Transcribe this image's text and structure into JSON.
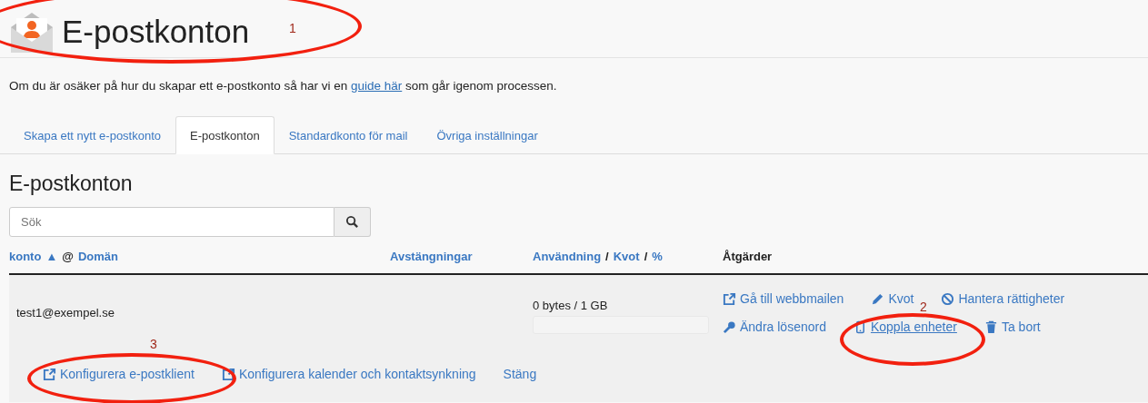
{
  "page_title": "E-postkonton",
  "intro": {
    "before": "Om du är osäker på hur du skapar ett e-postkonto så har vi en",
    "link": "guide här",
    "after": "som går igenom processen."
  },
  "tabs": [
    {
      "label": "Skapa ett nytt e-postkonto",
      "selected": false
    },
    {
      "label": "E-postkonton",
      "selected": true
    },
    {
      "label": "Standardkonto för mail",
      "selected": false
    },
    {
      "label": "Övriga inställningar",
      "selected": false
    }
  ],
  "section_title": "E-postkonton",
  "search": {
    "placeholder": "Sök"
  },
  "table": {
    "columns": [
      {
        "parts": [
          {
            "text": "konto",
            "link": true
          },
          {
            "text": "▲",
            "link": true
          },
          {
            "text": "@",
            "link": false
          },
          {
            "text": "Domän",
            "link": true
          }
        ]
      },
      {
        "parts": [
          {
            "text": "Avstängningar",
            "link": true
          }
        ]
      },
      {
        "parts": [
          {
            "text": "Användning",
            "link": true
          },
          {
            "text": "/",
            "link": false
          },
          {
            "text": "Kvot",
            "link": true
          },
          {
            "text": "/",
            "link": false
          },
          {
            "text": "%",
            "link": true
          }
        ]
      },
      {
        "parts": [
          {
            "text": "Åtgärder",
            "link": false
          }
        ]
      }
    ],
    "rows": [
      {
        "account": "test1@exempel.se",
        "usage": "0 bytes / 1 GB",
        "level": 0,
        "actions": [
          [
            {
              "kind": "external",
              "label": "Gå till webbmailen"
            },
            {
              "kind": "pencil",
              "label": "Kvot"
            },
            {
              "kind": "ban",
              "label": "Hantera rättigheter"
            }
          ],
          [
            {
              "kind": "key",
              "label": "Ändra lösenord"
            },
            {
              "kind": "phone",
              "label": "Koppla enheter"
            },
            {
              "kind": "trash",
              "label": "Ta bort"
            }
          ]
        ],
        "footer_links": [
          {
            "kind": "external",
            "label": "Konfigurera e-postklient"
          },
          {
            "kind": "external",
            "label": "Konfigurera kalender och kontaktsynkning"
          },
          {
            "kind": "plain",
            "label": "Stäng"
          }
        ]
      }
    ]
  },
  "annotations": [
    {
      "label": "1"
    },
    {
      "label": "2"
    },
    {
      "label": "3"
    }
  ]
}
